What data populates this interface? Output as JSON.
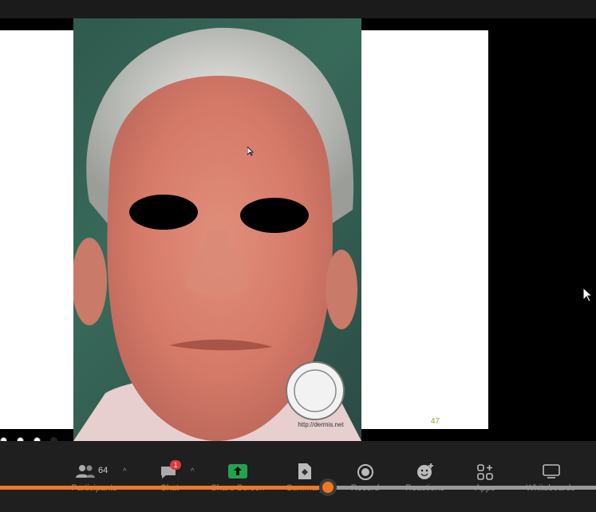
{
  "slide": {
    "page_number": "47",
    "watermark_url": "http://dermis.net"
  },
  "controls": {
    "participants": {
      "label": "Participants",
      "count": "64"
    },
    "chat": {
      "label": "Chat",
      "badge": "1"
    },
    "share_screen": {
      "label": "Share Screen"
    },
    "summary": {
      "label": "Summary"
    },
    "record": {
      "label": "Record"
    },
    "reactions": {
      "label": "Reactions"
    },
    "apps": {
      "label": "Apps"
    },
    "whiteboards": {
      "label": "Whiteboards"
    }
  },
  "playback": {
    "progress": 0.55
  },
  "colors": {
    "accent": "#f07822",
    "badge": "#e0373f",
    "share": "#23a24d"
  }
}
